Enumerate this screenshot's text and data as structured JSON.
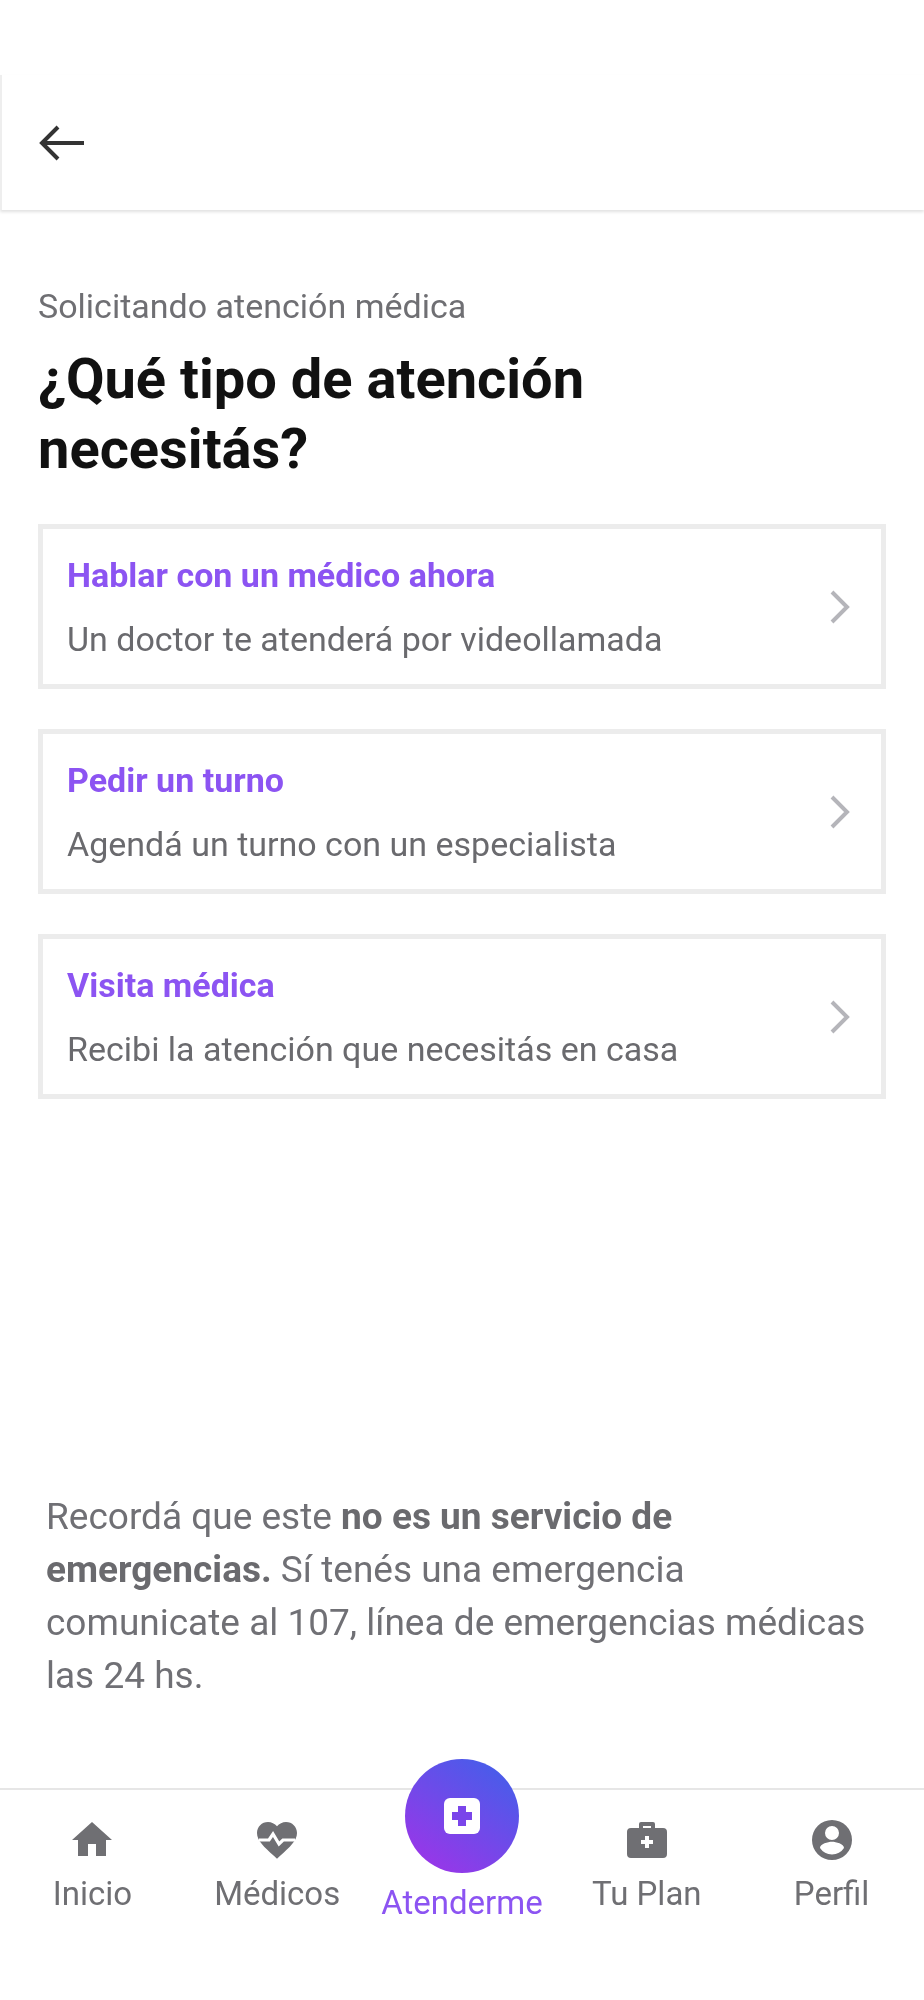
{
  "subtitle": "Solicitando atención médica",
  "title": "¿Qué tipo de atención necesitás?",
  "options": [
    {
      "title": "Hablar con un médico ahora",
      "description": "Un doctor te atenderá por videollamada"
    },
    {
      "title": "Pedir un turno",
      "description": "Agendá un turno con un especialista"
    },
    {
      "title": "Visita médica",
      "description": "Recibi la atención que necesitás en casa"
    }
  ],
  "notice": "Recordá que este **no es un servicio de emergencias.** Sí tenés una emergencia comunicate al 107, línea de emergencias médicas las 24 hs.",
  "nav": [
    {
      "label": "Inicio",
      "selected": false
    },
    {
      "label": "Médicos",
      "selected": false
    },
    {
      "label": "Atenderme",
      "selected": true
    },
    {
      "label": "Tu Plan",
      "selected": false
    },
    {
      "label": "Perfil",
      "selected": false
    }
  ]
}
